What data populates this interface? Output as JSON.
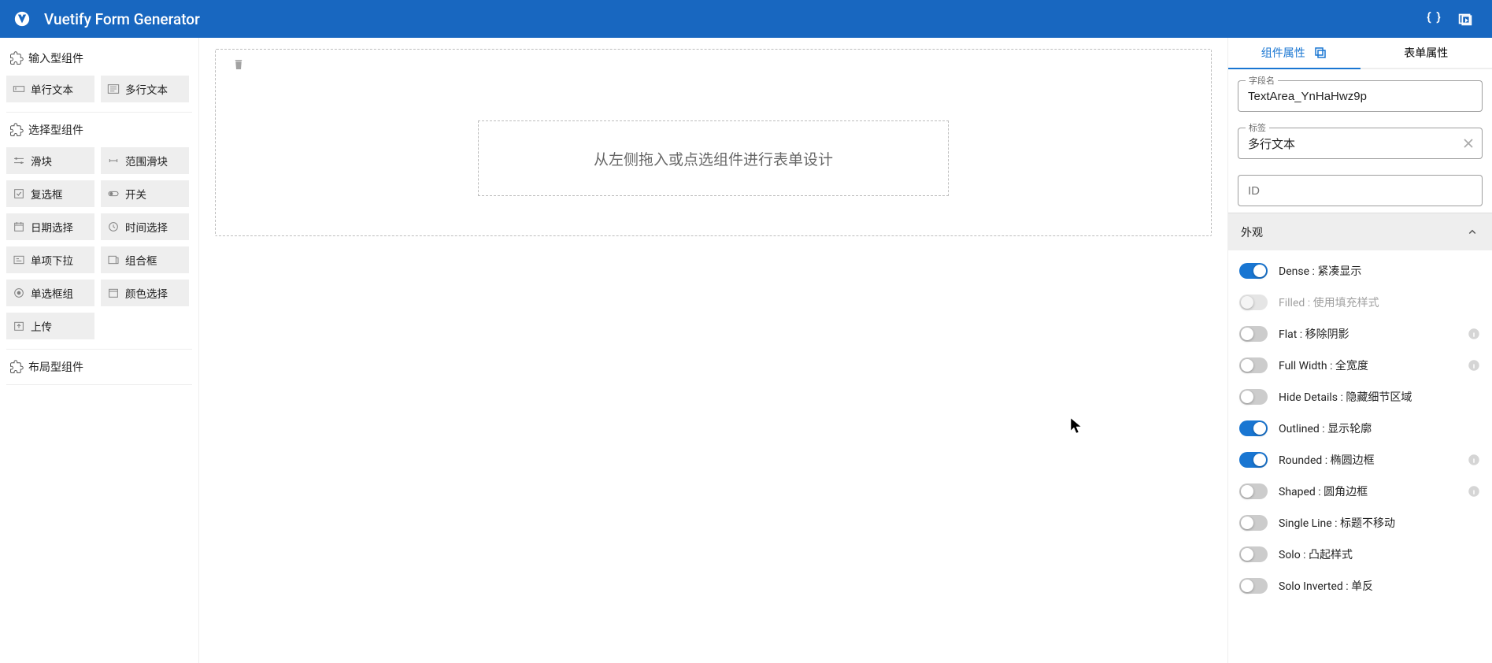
{
  "app": {
    "title": "Vuetify Form Generator"
  },
  "leftPanel": {
    "cat_input": "输入型组件",
    "cat_select": "选择型组件",
    "cat_layout": "布局型组件",
    "input_items": {
      "single_line": "单行文本",
      "multi_line": "多行文本"
    },
    "select_items": {
      "slider": "滑块",
      "range_slider": "范围滑块",
      "checkbox": "复选框",
      "switch": "开关",
      "date": "日期选择",
      "time": "时间选择",
      "single_select": "单项下拉",
      "combo": "组合框",
      "radio_group": "单选框组",
      "color": "颜色选择",
      "upload": "上传"
    }
  },
  "canvas": {
    "placeholder": "从左侧拖入或点选组件进行表单设计"
  },
  "rightPanel": {
    "tab_component": "组件属性",
    "tab_form": "表单属性",
    "field_name_label": "字段名",
    "field_name_value": "TextArea_YnHaHwz9p",
    "label_label": "标签",
    "label_value": "多行文本",
    "id_label": "ID",
    "id_value": "",
    "acc_appearance": "外观",
    "switches": {
      "dense": "Dense : 紧凑显示",
      "filled": "Filled : 使用填充样式",
      "flat": "Flat : 移除阴影",
      "full_width": "Full Width : 全宽度",
      "hide_details": "Hide Details : 隐藏细节区域",
      "outlined": "Outlined : 显示轮廓",
      "rounded": "Rounded : 椭圆边框",
      "shaped": "Shaped : 圆角边框",
      "single_line": "Single Line : 标题不移动",
      "solo": "Solo : 凸起样式",
      "solo_inverted": "Solo Inverted : 单反"
    }
  }
}
